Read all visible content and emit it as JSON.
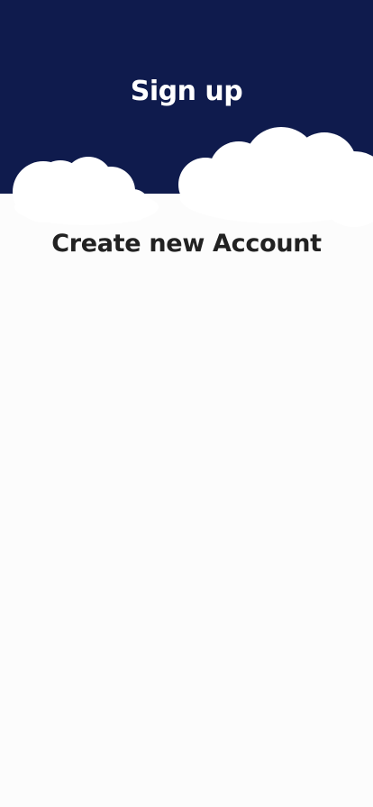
{
  "header": {
    "title": "Sign up"
  },
  "main": {
    "subtitle": "Create new Account"
  },
  "colors": {
    "header_bg": "#0f1b4d",
    "page_bg": "#fcfcfc",
    "cloud": "#ffffff",
    "title_text": "#ffffff",
    "subtitle_text": "#222222"
  }
}
